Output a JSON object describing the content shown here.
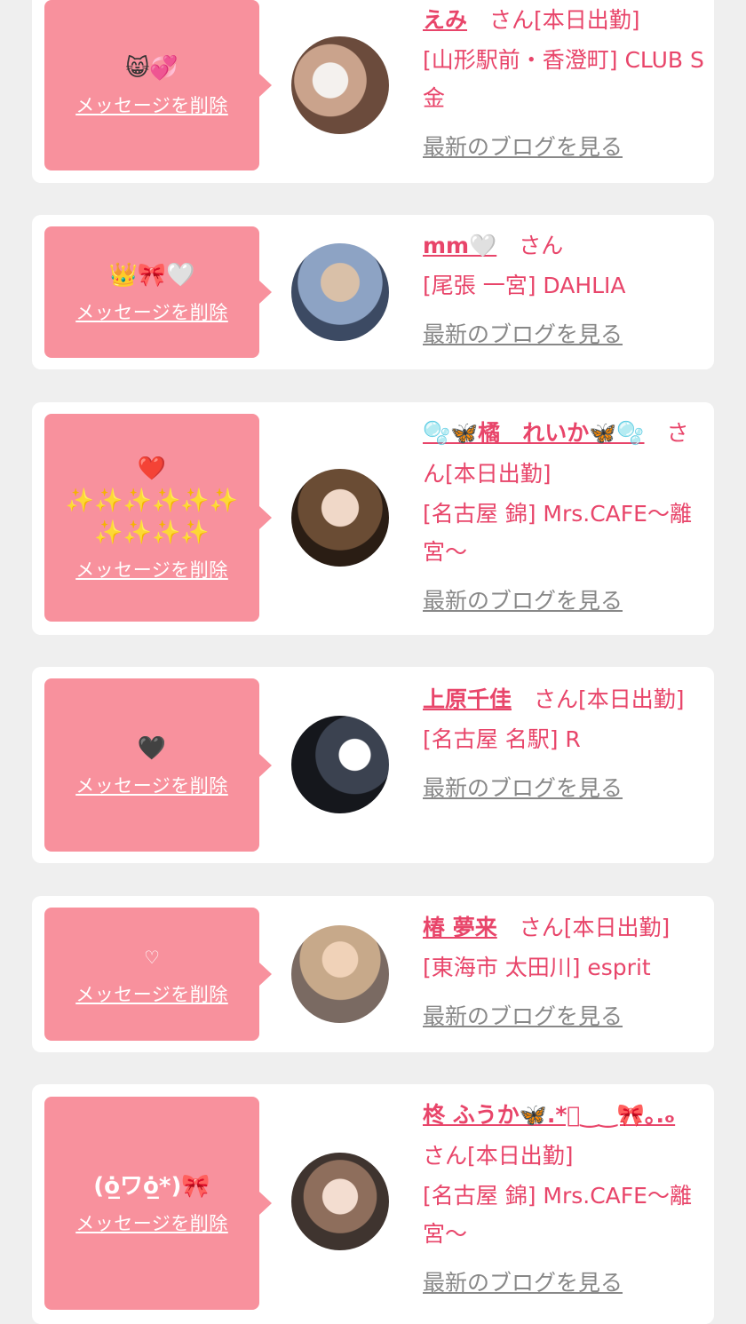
{
  "cards": [
    {
      "message": "😸💞",
      "delete_label": "メッセージを削除",
      "name": "えみ",
      "san": "　さん[本日出勤]",
      "shop": "[山形駅前・香澄町] CLUB S金",
      "blog_label": "最新のブログを見る"
    },
    {
      "message": "👑🎀🤍",
      "delete_label": "メッセージを削除",
      "name": "mm🤍",
      "san": "　さん",
      "shop": "[尾張 一宮] DAHLIA",
      "blog_label": "最新のブログを見る"
    },
    {
      "message": "❤️\n✨✨✨✨✨✨\n✨✨✨✨",
      "delete_label": "メッセージを削除",
      "name": "🫧🦋橘　れいか🦋🫧",
      "san": "　さん[本日出勤]",
      "shop": "[名古屋 錦] Mrs.CAFE〜離宮〜",
      "blog_label": "最新のブログを見る"
    },
    {
      "message": "🖤",
      "delete_label": "メッセージを削除",
      "name": "上原千佳",
      "san": "　さん[本日出勤]",
      "shop": "[名古屋 名駅] R",
      "blog_label": "最新のブログを見る"
    },
    {
      "message": "♡",
      "delete_label": "メッセージを削除",
      "name": "椿 夢来",
      "san": "　さん[本日出勤]",
      "shop": "[東海市 太田川] esprit",
      "blog_label": "最新のブログを見る"
    },
    {
      "message": "(ȯ̲ワȯ̲*)🎀",
      "delete_label": "メッセージを削除",
      "name": "柊 ふうか🦋.*ﾟ‿‿🎀｡.ₒ",
      "san": "　さん[本日出勤]",
      "shop": "[名古屋 錦] Mrs.CAFE〜離宮〜",
      "blog_label": "最新のブログを見る"
    }
  ],
  "colors": {
    "pink_bubble": "#f8919d",
    "name_pink": "#e8456a",
    "link_gray": "#888888",
    "background": "#efefef"
  }
}
